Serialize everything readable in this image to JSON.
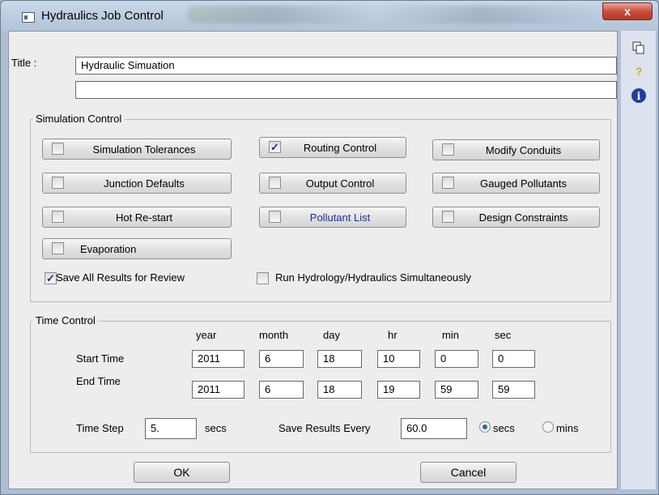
{
  "window": {
    "title": "Hydraulics Job Control",
    "close_label": "x"
  },
  "side_icons": [
    {
      "name": "copy-icon",
      "glyph": "⧉"
    },
    {
      "name": "help-icon",
      "glyph": "?"
    },
    {
      "name": "info-icon",
      "glyph": "i"
    }
  ],
  "title_section": {
    "label": "Title :",
    "line1": "Hydraulic Simuation",
    "line2": ""
  },
  "simulation_control": {
    "label": "Simulation Control",
    "buttons": [
      {
        "label": "Simulation Tolerances",
        "checked": false
      },
      {
        "label": "Routing Control",
        "checked": true
      },
      {
        "label": "Modify Conduits",
        "checked": false
      },
      {
        "label": "Junction Defaults",
        "checked": false
      },
      {
        "label": "Output Control",
        "checked": false
      },
      {
        "label": "Gauged Pollutants",
        "checked": false
      },
      {
        "label": "Hot Re-start",
        "checked": false
      },
      {
        "label": "Pollutant List",
        "checked": false
      },
      {
        "label": "Design Constraints",
        "checked": false
      },
      {
        "label": "Evaporation",
        "checked": false
      }
    ],
    "save_all": {
      "label": "Save All Results for Review",
      "checked": true
    },
    "run_simul": {
      "label": "Run Hydrology/Hydraulics Simultaneously",
      "checked": false
    }
  },
  "time_control": {
    "label": "Time Control",
    "columns": [
      "year",
      "month",
      "day",
      "hr",
      "min",
      "sec"
    ],
    "start": {
      "label": "Start Time",
      "values": [
        "2011",
        "6",
        "18",
        "10",
        "0",
        "0"
      ]
    },
    "end": {
      "label": "End Time",
      "values": [
        "2011",
        "6",
        "18",
        "19",
        "59",
        "59"
      ]
    },
    "time_step": {
      "label": "Time Step",
      "value": "5.",
      "unit": "secs"
    },
    "save_every": {
      "label": "Save Results Every",
      "value": "60.0"
    },
    "units": [
      {
        "label": "secs",
        "selected": true
      },
      {
        "label": "mins",
        "selected": false
      }
    ]
  },
  "buttons": {
    "ok": "OK",
    "cancel": "Cancel"
  },
  "colors": {
    "link_text": "#1f2fa8",
    "check_mark": "#1a2f7a"
  }
}
